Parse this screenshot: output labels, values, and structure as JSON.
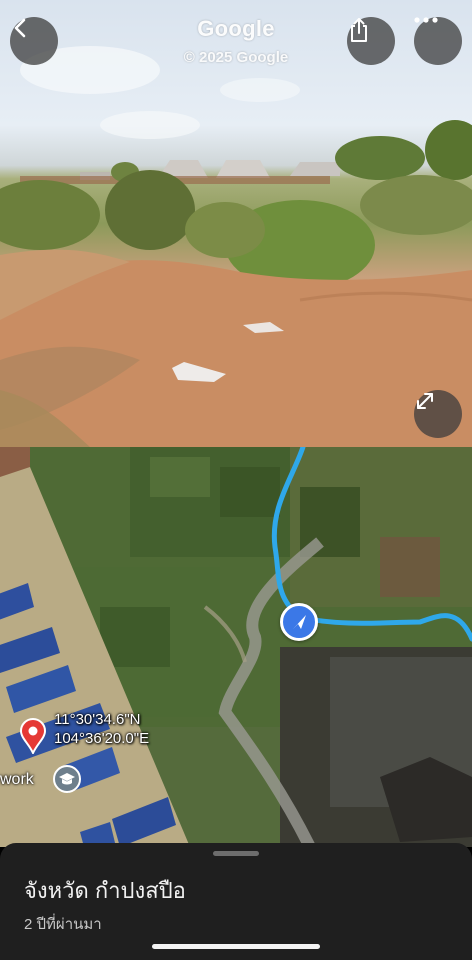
{
  "street_view": {
    "title": "Google",
    "copyright": "© 2025 Google"
  },
  "icons": {
    "back": "chevron-left-icon",
    "share": "share-icon",
    "more": "more-horizontal-icon",
    "expand": "expand-icon",
    "pin": "location-pin-icon",
    "place": "graduation-cap-icon",
    "user": "navigation-arrow-icon"
  },
  "map": {
    "latitude": "11°30'34.6\"N",
    "longitude": "104°36'20.0\"E",
    "place_label": "work",
    "path_color": "#2fa8ea",
    "pin_color": "#e53935"
  },
  "sheet": {
    "title": "จังหวัด กำปงสปือ",
    "subtitle": "2 ปีที่ผ่านมา"
  }
}
